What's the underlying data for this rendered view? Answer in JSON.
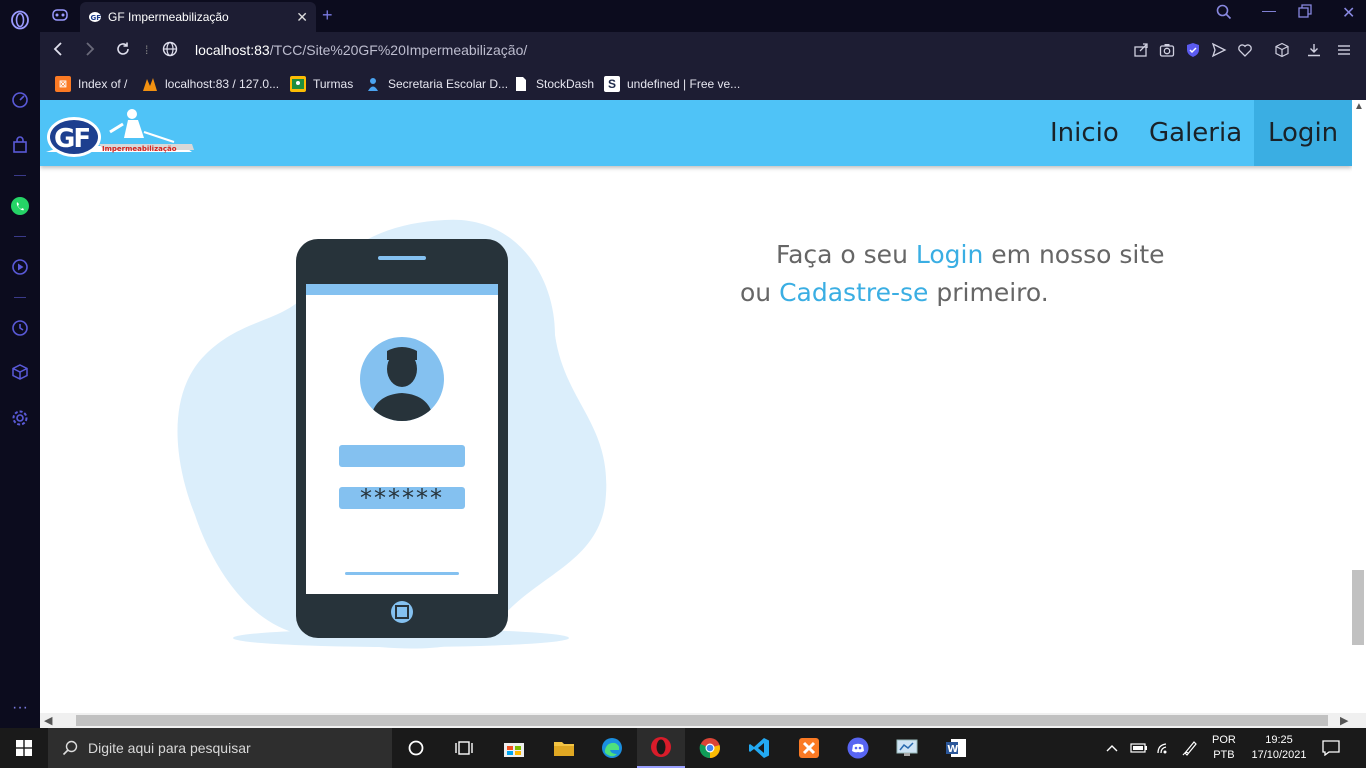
{
  "browser": {
    "tab": {
      "title": "GF Impermeabilização"
    },
    "address": {
      "host": "localhost:83",
      "path": "/TCC/Site%20GF%20Impermeabilização/"
    },
    "bookmarks": [
      {
        "label": "Index of /"
      },
      {
        "label": "localhost:83 / 127.0..."
      },
      {
        "label": "Turmas"
      },
      {
        "label": "Secretaria Escolar D..."
      },
      {
        "label": "StockDash"
      },
      {
        "label": "undefined | Free ve..."
      }
    ]
  },
  "site": {
    "logo": {
      "text": "GF",
      "subtitle": "Impermeabilização"
    },
    "nav": [
      {
        "label": "Inicio"
      },
      {
        "label": "Galeria"
      },
      {
        "label": "Login"
      }
    ],
    "headline": {
      "part1": "Faça o seu ",
      "login_link": "Login",
      "part2": " em nosso site",
      "part3": "ou ",
      "signup_link": "Cadastre-se",
      "part4": " primeiro."
    },
    "illustration": {
      "password_mask": "******"
    }
  },
  "taskbar": {
    "search_placeholder": "Digite aqui para pesquisar",
    "language": "POR",
    "keyboard": "PTB",
    "time": "19:25",
    "date": "17/10/2021"
  }
}
